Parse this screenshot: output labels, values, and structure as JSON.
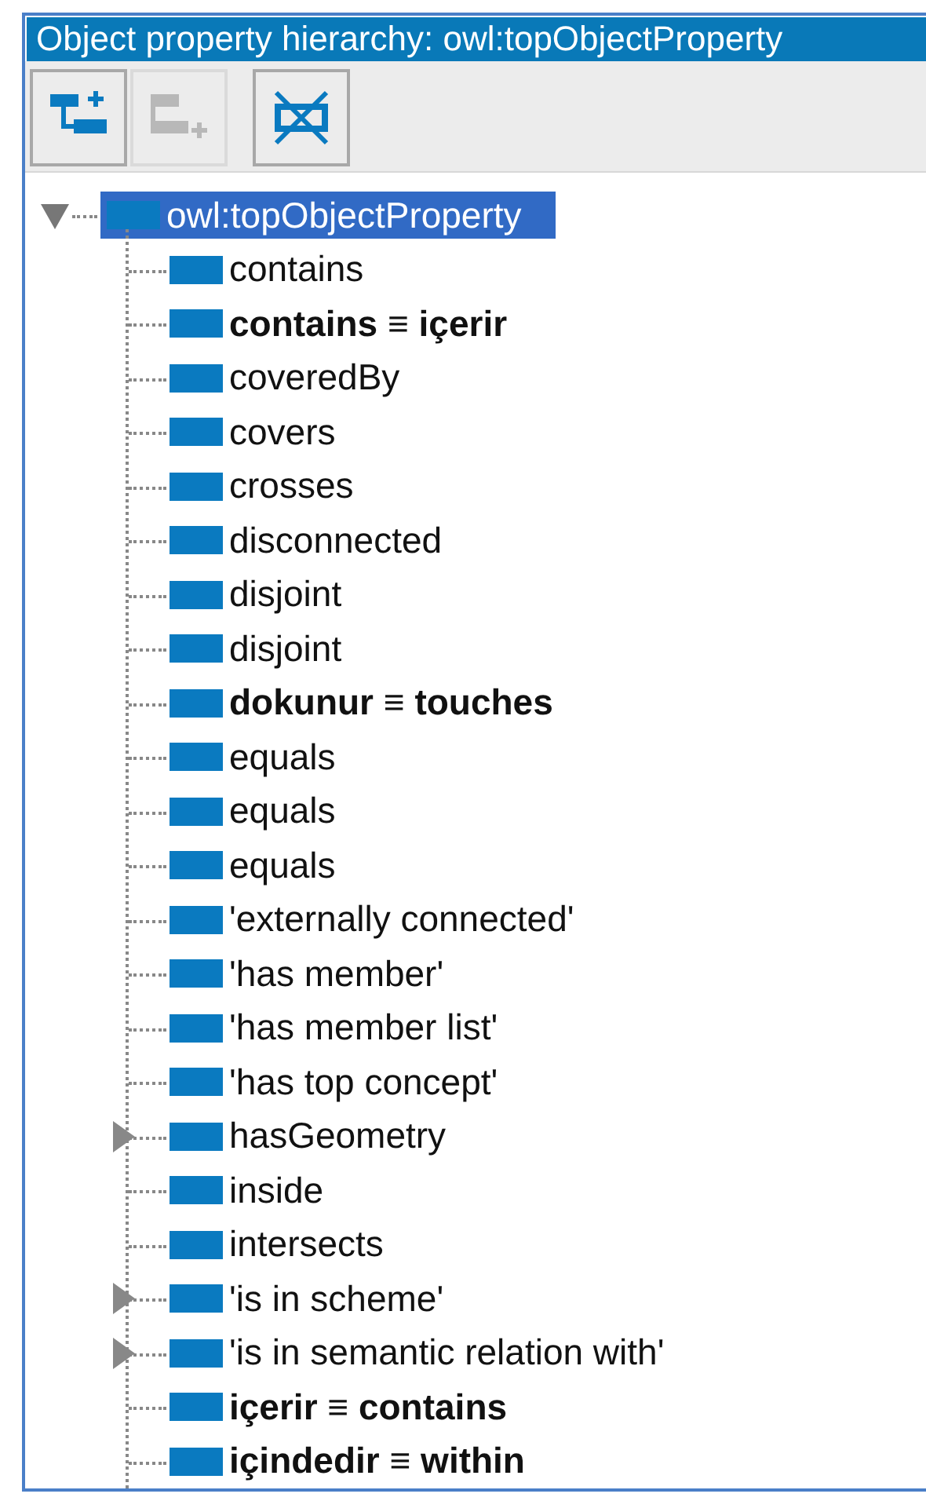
{
  "panel": {
    "title": "Object property hierarchy: owl:topObjectProperty"
  },
  "toolbar": [
    {
      "kind": "add-sub",
      "disabled": false
    },
    {
      "kind": "add-sibling",
      "disabled": true
    },
    {
      "kind": "delete",
      "disabled": false
    }
  ],
  "tree": {
    "label": "owl:topObjectProperty",
    "expanded": true,
    "selected": true,
    "children": [
      {
        "label": "contains",
        "bold": false,
        "has_children": false
      },
      {
        "label": "contains ≡ içerir",
        "bold": true,
        "has_children": false
      },
      {
        "label": "coveredBy",
        "bold": false,
        "has_children": false
      },
      {
        "label": "covers",
        "bold": false,
        "has_children": false
      },
      {
        "label": "crosses",
        "bold": false,
        "has_children": false
      },
      {
        "label": "disconnected",
        "bold": false,
        "has_children": false
      },
      {
        "label": "disjoint",
        "bold": false,
        "has_children": false
      },
      {
        "label": "disjoint",
        "bold": false,
        "has_children": false
      },
      {
        "label": "dokunur ≡ touches",
        "bold": true,
        "has_children": false
      },
      {
        "label": "equals",
        "bold": false,
        "has_children": false
      },
      {
        "label": "equals",
        "bold": false,
        "has_children": false
      },
      {
        "label": "equals",
        "bold": false,
        "has_children": false
      },
      {
        "label": "'externally connected'",
        "bold": false,
        "has_children": false
      },
      {
        "label": "'has member'",
        "bold": false,
        "has_children": false
      },
      {
        "label": "'has member list'",
        "bold": false,
        "has_children": false
      },
      {
        "label": "'has top concept'",
        "bold": false,
        "has_children": false
      },
      {
        "label": "hasGeometry",
        "bold": false,
        "has_children": true
      },
      {
        "label": "inside",
        "bold": false,
        "has_children": false
      },
      {
        "label": "intersects",
        "bold": false,
        "has_children": false
      },
      {
        "label": "'is in scheme'",
        "bold": false,
        "has_children": true
      },
      {
        "label": "'is in semantic relation with'",
        "bold": false,
        "has_children": true
      },
      {
        "label": "içerir ≡ contains",
        "bold": true,
        "has_children": false
      },
      {
        "label": "içindedir ≡ within",
        "bold": true,
        "has_children": false
      }
    ]
  }
}
